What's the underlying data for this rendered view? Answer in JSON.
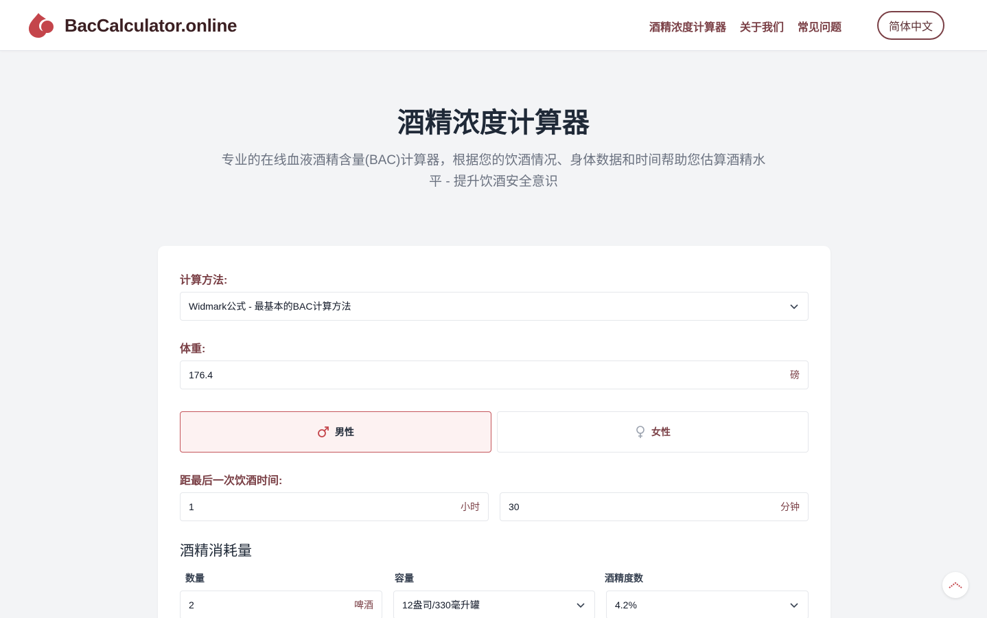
{
  "header": {
    "logo_text": "BacCalculator.online",
    "nav": [
      "酒精浓度计算器",
      "关于我们",
      "常见问题"
    ],
    "lang": "简体中文"
  },
  "hero": {
    "title": "酒精浓度计算器",
    "subtitle_line1": "专业的在线血液酒精含量(BAC)计算器，根据您的饮酒情况、身体数据和时间帮助您估算酒精水",
    "subtitle_line2": "平 - 提升饮酒安全意识"
  },
  "form": {
    "method_label": "计算方法:",
    "method_value": "Widmark公式 - 最基本的BAC计算方法",
    "weight_label": "体重:",
    "weight_value": "176.4",
    "weight_unit": "磅",
    "gender_male": "男性",
    "gender_female": "女性",
    "time_label": "距最后一次饮酒时间:",
    "hours_value": "1",
    "hours_unit": "小时",
    "minutes_value": "30",
    "minutes_unit": "分钟",
    "section_title": "酒精消耗量",
    "qty_label": "数量",
    "qty_value": "2",
    "qty_unit": "啤酒",
    "volume_label": "容量",
    "volume_value": "12盎司/330毫升罐",
    "abv_label": "酒精度数",
    "abv_value": "4.2%"
  },
  "colors": {
    "accent": "#7a3f45",
    "brand_red": "#c4454b",
    "active_bg": "#fdf2f2"
  },
  "icons": [
    "logo-drop-icon",
    "male-icon",
    "female-icon",
    "chevron-down-icon",
    "scroll-top-icon"
  ]
}
